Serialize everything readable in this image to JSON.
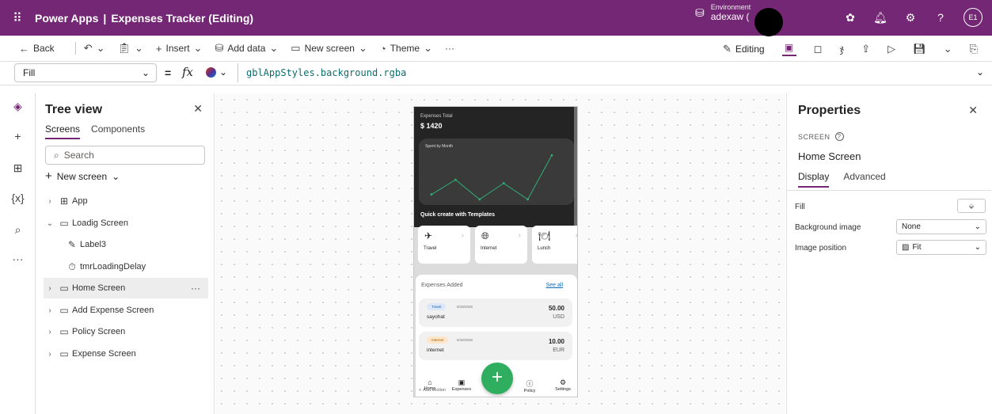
{
  "topbar": {
    "app_name": "Power Apps",
    "separator": "|",
    "document_title": "Expenses Tracker (Editing)",
    "environment_label": "Environment",
    "environment_name": "adexaw (",
    "avatar_initials": "E1"
  },
  "commandbar": {
    "back": "Back",
    "insert": "Insert",
    "add_data": "Add data",
    "new_screen": "New screen",
    "theme": "Theme",
    "more": "···",
    "editing": "Editing"
  },
  "formulabar": {
    "property": "Fill",
    "equals": "=",
    "fx": "fx",
    "formula": "gblAppStyles.background.rgba"
  },
  "tree": {
    "title": "Tree view",
    "tabs": [
      "Screens",
      "Components"
    ],
    "search_placeholder": "Search",
    "new_screen": "New screen",
    "items": [
      {
        "label": "App"
      },
      {
        "label": "Loadig Screen"
      },
      {
        "label": "Label3"
      },
      {
        "label": "tmrLoadingDelay"
      },
      {
        "label": "Home Screen"
      },
      {
        "label": "Add Expense Screen"
      },
      {
        "label": "Policy Screen"
      },
      {
        "label": "Expense Screen"
      }
    ]
  },
  "phone": {
    "expenses_total_label": "Expenses Total",
    "expenses_total_value": "$ 1420",
    "chart_title": "Spent by Month",
    "quick_create": "Quick create with Templates",
    "templates": [
      "Travel",
      "Internet",
      "Lunch"
    ],
    "expenses_added": "Expenses Added",
    "see_all": "See all",
    "expenses": [
      {
        "tag": "Travel",
        "date": "5/18/2025",
        "name": "sayohat",
        "amount": "50.00",
        "currency": "USD",
        "tag_color": "#dce7f8"
      },
      {
        "tag": "Internet",
        "date": "5/18/2025",
        "name": "internet",
        "amount": "10.00",
        "currency": "EUR",
        "tag_color": "#fde6c9"
      }
    ],
    "nav": [
      "Home",
      "Expenses",
      "Policy",
      "Settings"
    ],
    "fab": "+",
    "add_section": "Add section"
  },
  "properties": {
    "title": "Properties",
    "type": "SCREEN",
    "name": "Home Screen",
    "tabs": [
      "Display",
      "Advanced"
    ],
    "fill_label": "Fill",
    "background_image_label": "Background image",
    "background_image_value": "None",
    "image_position_label": "Image position",
    "image_position_value": "Fit"
  },
  "chart_data": {
    "type": "line",
    "title": "Spent by Month",
    "values": [
      0.15,
      0.45,
      0.05,
      0.38,
      0.05,
      0.95
    ],
    "color": "#2fae78"
  }
}
